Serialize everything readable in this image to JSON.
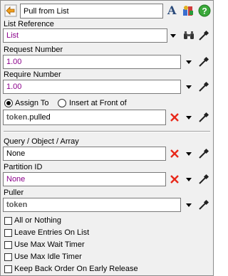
{
  "header": {
    "title": "Pull from List",
    "icons": [
      "back-arrow-icon",
      "font-a-icon",
      "template-icon",
      "help-icon"
    ]
  },
  "list_reference": {
    "label": "List Reference",
    "value": "List"
  },
  "request_number": {
    "label": "Request Number",
    "value": "1.00"
  },
  "require_number": {
    "label": "Require Number",
    "value": "1.00"
  },
  "assign": {
    "option_assign_to": "Assign To",
    "option_insert_front": "Insert at Front of",
    "selected": "Assign To",
    "value_bold": "token",
    "value_rest": ".pulled"
  },
  "query": {
    "label": "Query / Object / Array",
    "value": "None"
  },
  "partition": {
    "label": "Partition ID",
    "value": "None"
  },
  "puller": {
    "label": "Puller",
    "value": "token"
  },
  "checkboxes": [
    {
      "label": "All or Nothing",
      "checked": false
    },
    {
      "label": "Leave Entries On List",
      "checked": false
    },
    {
      "label": "Use Max Wait Timer",
      "checked": false
    },
    {
      "label": "Use Max Idle Timer",
      "checked": false
    },
    {
      "label": "Keep Back Order On Early Release",
      "checked": false
    }
  ],
  "colors": {
    "purple_value": "#8b008b",
    "red_x": "#e8281a",
    "help_green": "#3aa83a"
  }
}
